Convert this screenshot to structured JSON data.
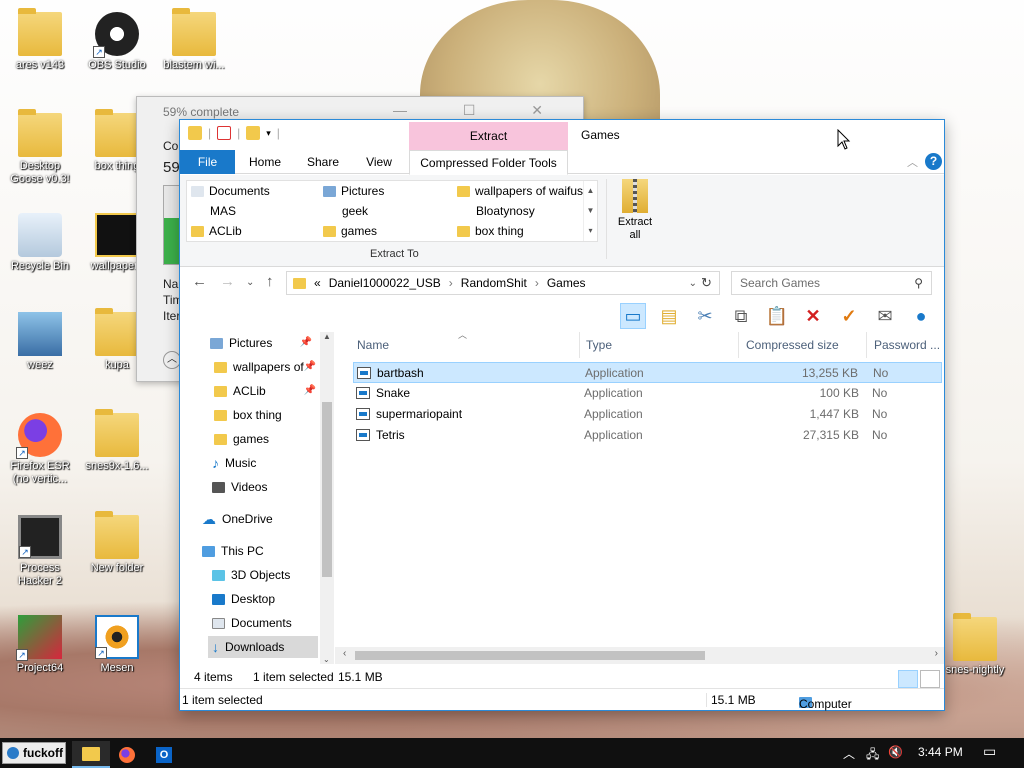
{
  "desktop": {
    "icons": [
      {
        "label": "ares v143",
        "icon": "folder-icon"
      },
      {
        "label": "OBS Studio",
        "icon": "obs-icon"
      },
      {
        "label": "blastem wi...",
        "icon": "folder-icon"
      },
      {
        "label": "Desktop Goose v0.3!",
        "icon": "folder-icon"
      },
      {
        "label": "box thing",
        "icon": "folder-icon"
      },
      {
        "label": "Recycle Bin",
        "icon": "recycle-bin-icon"
      },
      {
        "label": "wallpapers",
        "icon": "wallpapers-icon"
      },
      {
        "label": "weez",
        "icon": "weezer-image-icon"
      },
      {
        "label": "kupa",
        "icon": "folder-icon"
      },
      {
        "label": "Firefox ESR (no vertic...",
        "icon": "firefox-icon"
      },
      {
        "label": "snes9x-1.6...",
        "icon": "folder-icon"
      },
      {
        "label": "Process Hacker 2",
        "icon": "process-hacker-icon"
      },
      {
        "label": "New folder",
        "icon": "folder-icon"
      },
      {
        "label": "Project64",
        "icon": "project64-icon"
      },
      {
        "label": "Mesen",
        "icon": "mesen-icon"
      },
      {
        "label": "snes-nightly",
        "icon": "folder-icon"
      }
    ]
  },
  "progress_dialog": {
    "title": "59% complete",
    "line1": "Co",
    "line2": "59",
    "fields": [
      "Na",
      "Tim",
      "Iter"
    ],
    "fraction": 0.59
  },
  "explorer": {
    "context_tab": "Extract",
    "title": "Games",
    "tabs": {
      "file": "File",
      "home": "Home",
      "share": "Share",
      "view": "View",
      "tools": "Compressed Folder Tools"
    },
    "gallery": [
      [
        "Documents",
        "Pictures",
        "wallpapers of waifus"
      ],
      [
        "MAS",
        "geek",
        "Bloatynosy"
      ],
      [
        "ACLib",
        "games",
        "box thing"
      ]
    ],
    "extract_to_label": "Extract To",
    "extract_all_label": "Extract all",
    "address": {
      "overflow": "«",
      "crumbs": [
        "Daniel1000022_USB",
        "RandomShit",
        "Games"
      ]
    },
    "search_placeholder": "Search Games",
    "nav_items": [
      {
        "label": "Pictures",
        "icon": "pictures-icon",
        "pinned": true
      },
      {
        "label": "wallpapers of",
        "icon": "folder-icon",
        "pinned": true
      },
      {
        "label": "ACLib",
        "icon": "folder-icon",
        "pinned": true
      },
      {
        "label": "box thing",
        "icon": "folder-icon",
        "pinned": false
      },
      {
        "label": "games",
        "icon": "folder-icon",
        "pinned": false
      },
      {
        "label": "Music",
        "icon": "music-icon",
        "pinned": false
      },
      {
        "label": "Videos",
        "icon": "videos-icon",
        "pinned": false
      },
      {
        "label": "OneDrive",
        "icon": "onedrive-icon",
        "pinned": false
      },
      {
        "label": "This PC",
        "icon": "this-pc-icon",
        "pinned": false
      },
      {
        "label": "3D Objects",
        "icon": "3d-objects-icon",
        "pinned": false
      },
      {
        "label": "Desktop",
        "icon": "desktop-icon",
        "pinned": false
      },
      {
        "label": "Documents",
        "icon": "documents-icon",
        "pinned": false
      },
      {
        "label": "Downloads",
        "icon": "downloads-icon",
        "pinned": false
      }
    ],
    "columns": [
      "Name",
      "Type",
      "Compressed size",
      "Password ..."
    ],
    "files": [
      {
        "name": "bartbash",
        "type": "Application",
        "size": "13,255 KB",
        "password": "No",
        "selected": true
      },
      {
        "name": "Snake",
        "type": "Application",
        "size": "100 KB",
        "password": "No",
        "selected": false
      },
      {
        "name": "supermariopaint",
        "type": "Application",
        "size": "1,447 KB",
        "password": "No",
        "selected": false
      },
      {
        "name": "Tetris",
        "type": "Application",
        "size": "27,315 KB",
        "password": "No",
        "selected": false
      }
    ],
    "status": {
      "items": "4 items",
      "selected": "1 item selected",
      "selected_size": "15.1 MB",
      "details": "1 item selected",
      "details_size": "15.1 MB",
      "location": "Computer"
    }
  },
  "taskbar": {
    "start_label": "fuckoff",
    "clock": "3:44 PM"
  }
}
